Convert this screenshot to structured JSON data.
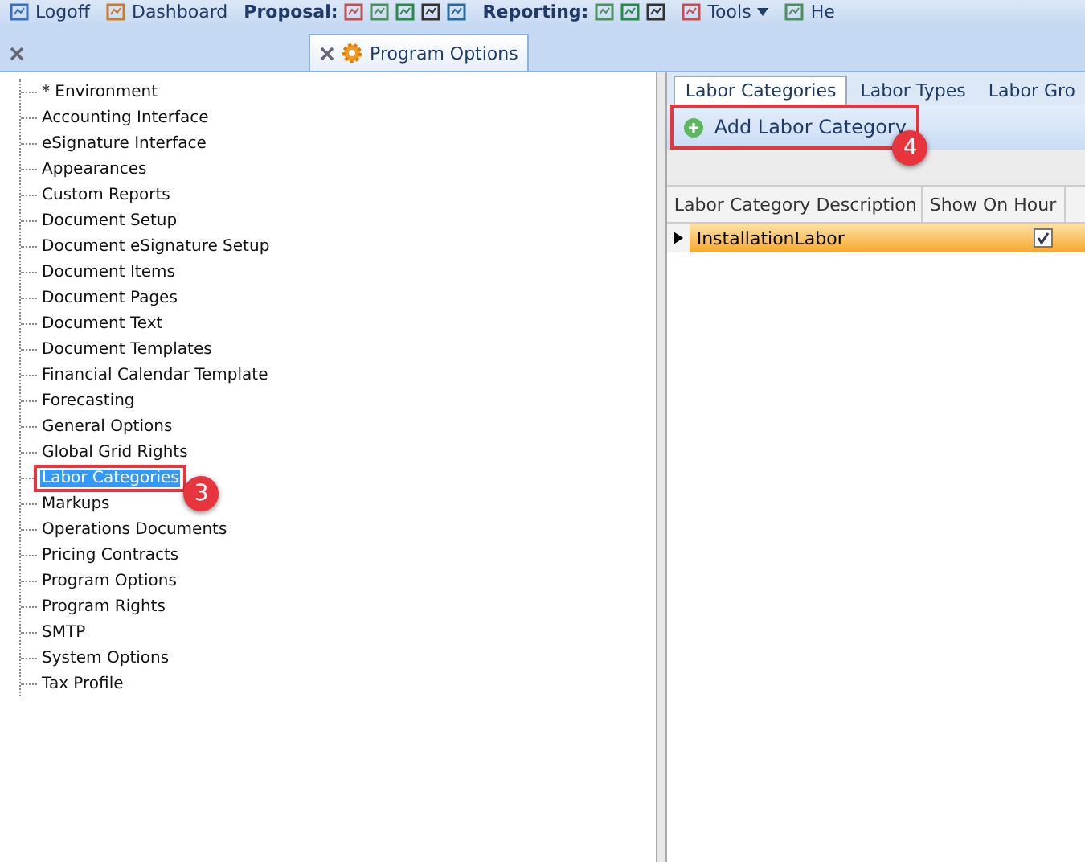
{
  "toolbar": {
    "items": [
      {
        "kind": "button",
        "label": "Logoff"
      },
      {
        "kind": "button",
        "label": "Dashboard"
      },
      {
        "kind": "group",
        "label": "Proposal:"
      },
      {
        "kind": "group",
        "label": "Reporting:"
      },
      {
        "kind": "menu",
        "label": "Tools"
      },
      {
        "kind": "button",
        "label": "He"
      }
    ]
  },
  "doc_tabs": [
    {
      "selected": false
    },
    {
      "label": "Program Options",
      "selected": true
    }
  ],
  "tree": {
    "items": [
      {
        "label": "* Environment",
        "selected": false,
        "highlighted": false
      },
      {
        "label": "Accounting Interface",
        "selected": false,
        "highlighted": false
      },
      {
        "label": "eSignature Interface",
        "selected": false,
        "highlighted": false
      },
      {
        "label": "Appearances",
        "selected": false,
        "highlighted": false
      },
      {
        "label": "Custom Reports",
        "selected": false,
        "highlighted": false
      },
      {
        "label": "Document Setup",
        "selected": false,
        "highlighted": false
      },
      {
        "label": "Document eSignature Setup",
        "selected": false,
        "highlighted": false
      },
      {
        "label": "Document Items",
        "selected": false,
        "highlighted": false
      },
      {
        "label": "Document Pages",
        "selected": false,
        "highlighted": false
      },
      {
        "label": "Document Text",
        "selected": false,
        "highlighted": false
      },
      {
        "label": "Document Templates",
        "selected": false,
        "highlighted": false
      },
      {
        "label": "Financial Calendar Template",
        "selected": false,
        "highlighted": false
      },
      {
        "label": "Forecasting",
        "selected": false,
        "highlighted": false
      },
      {
        "label": "General Options",
        "selected": false,
        "highlighted": false
      },
      {
        "label": "Global Grid Rights",
        "selected": false,
        "highlighted": false
      },
      {
        "label": "Labor Categories",
        "selected": true,
        "highlighted": true,
        "callout": "3"
      },
      {
        "label": "Markups",
        "selected": false,
        "highlighted": false
      },
      {
        "label": "Operations Documents",
        "selected": false,
        "highlighted": false
      },
      {
        "label": "Pricing Contracts",
        "selected": false,
        "highlighted": false
      },
      {
        "label": "Program Options",
        "selected": false,
        "highlighted": false
      },
      {
        "label": "Program Rights",
        "selected": false,
        "highlighted": false
      },
      {
        "label": "SMTP",
        "selected": false,
        "highlighted": false
      },
      {
        "label": "System Options",
        "selected": false,
        "highlighted": false
      },
      {
        "label": "Tax Profile",
        "selected": false,
        "highlighted": false
      }
    ]
  },
  "right_tabs": [
    {
      "label": "Labor Categories",
      "selected": true
    },
    {
      "label": "Labor Types",
      "selected": false
    },
    {
      "label": "Labor Gro",
      "selected": false
    }
  ],
  "add_button": {
    "label": "Add Labor Category",
    "highlighted": true,
    "callout": "4"
  },
  "table": {
    "columns": [
      "Labor Category Description",
      "Show On Hour"
    ],
    "rows": [
      {
        "description": "InstallationLabor",
        "show_on_hours": true,
        "selected": true
      }
    ]
  }
}
